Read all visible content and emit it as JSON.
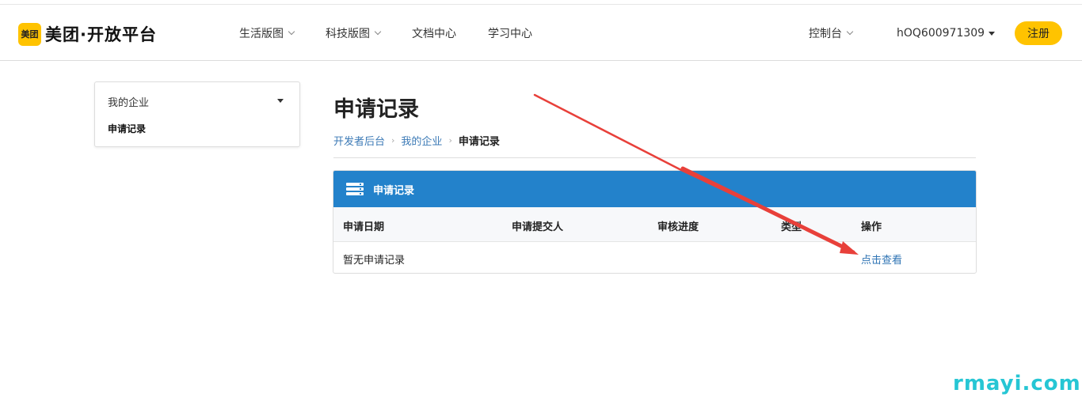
{
  "logo": {
    "badge": "美团",
    "text": "美团·开放平台"
  },
  "nav": {
    "items": [
      {
        "label": "生活版图",
        "has_dropdown": true
      },
      {
        "label": "科技版图",
        "has_dropdown": true
      },
      {
        "label": "文档中心",
        "has_dropdown": false
      },
      {
        "label": "学习中心",
        "has_dropdown": false
      }
    ],
    "console": "控制台",
    "user": "hOQ600971309",
    "register": "注册"
  },
  "sidebar": {
    "group": "我的企业",
    "active_item": "申请记录"
  },
  "main": {
    "title": "申请记录",
    "breadcrumb": [
      "开发者后台",
      "我的企业",
      "申请记录"
    ],
    "panel_title": "申请记录",
    "columns": [
      "申请日期",
      "申请提交人",
      "审核进度",
      "类型",
      "操作"
    ],
    "empty_text": "暂无申请记录",
    "action_link": "点击查看"
  },
  "watermark": "rmayi.com",
  "colors": {
    "brand_yellow": "#ffc300",
    "panel_blue": "#2382cb",
    "link_blue": "#2f74b4",
    "annotation_arrow": "#e8403a",
    "watermark": "#26c6d4"
  }
}
